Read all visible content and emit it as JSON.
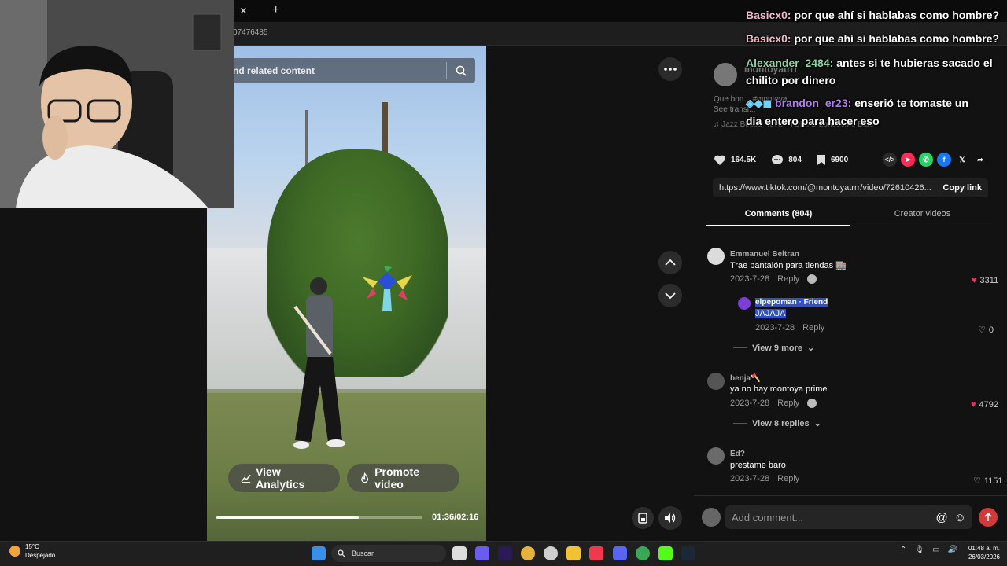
{
  "browser": {
    "tab_close": "✕",
    "new_tab": "+",
    "tab_title_fragment": "a:",
    "url_fragment": "07476485"
  },
  "video": {
    "search_placeholder": "nd related content",
    "view_analytics": "View Analytics",
    "promote_video": "Promote video",
    "timecode": "01:36/02:16",
    "progress": 0.69
  },
  "author": {
    "name": "montoyatrrr",
    "desc_line1": "Que bon... #montoya",
    "desc_line2": "See transl...",
    "music": "Jazz Bossa Nova - TOKYO Lonesome Blue"
  },
  "stats": {
    "likes": "164.5K",
    "comments": "804",
    "saves": "6900"
  },
  "link": {
    "url": "https://www.tiktok.com/@montoyatrrr/video/72610426...",
    "copy_label": "Copy link"
  },
  "tabs": {
    "comments": "Comments (804)",
    "creator": "Creator videos"
  },
  "comments": [
    {
      "user": "Emmanuel Beltran",
      "text": "Trae pantalón para tiendas 🏬",
      "date": "2023-7-28",
      "reply": "Reply",
      "likes": "3311"
    },
    {
      "user": "benja🪓",
      "text": "ya no hay montoya prime",
      "date": "2023-7-28",
      "reply": "Reply",
      "likes": "4792"
    },
    {
      "user": "Ed?",
      "text": "prestame baro",
      "date": "2023-7-28",
      "reply": "Reply",
      "likes": "1151"
    }
  ],
  "reply": {
    "user": "elpepoman · Friend",
    "text": "JAJAJA",
    "date": "2023-7-28",
    "reply": "Reply",
    "likes": "0"
  },
  "view_more": {
    "first": "View 9 more",
    "second": "View 8 replies"
  },
  "comment_input": {
    "placeholder": "Add comment..."
  },
  "chat": [
    {
      "user": "Basicx0:",
      "msg": "por que ahí si hablabas como hombre?",
      "color": "#f0b9c9"
    },
    {
      "user": "Basicx0:",
      "msg": "por que ahí si hablabas como hombre?",
      "color": "#f0b9c9"
    },
    {
      "user": "Alexander_2484:",
      "msg": "antes si te hubieras sacado el",
      "msg2": "chilito por dinero",
      "color": "#8fd3a4"
    },
    {
      "user": "brandon_er23:",
      "msg": "enserió te tomaste un",
      "msg2": "dia entero para hacer eso",
      "color": "#b07bf0"
    }
  ],
  "taskbar": {
    "temp": "15°C",
    "weather": "Despejado",
    "search": "Buscar",
    "time": "01:48 a. m.",
    "date": "26/03/2026"
  },
  "colors": {
    "accent_red": "#fe2c55",
    "highlight": "#2f51c9"
  }
}
